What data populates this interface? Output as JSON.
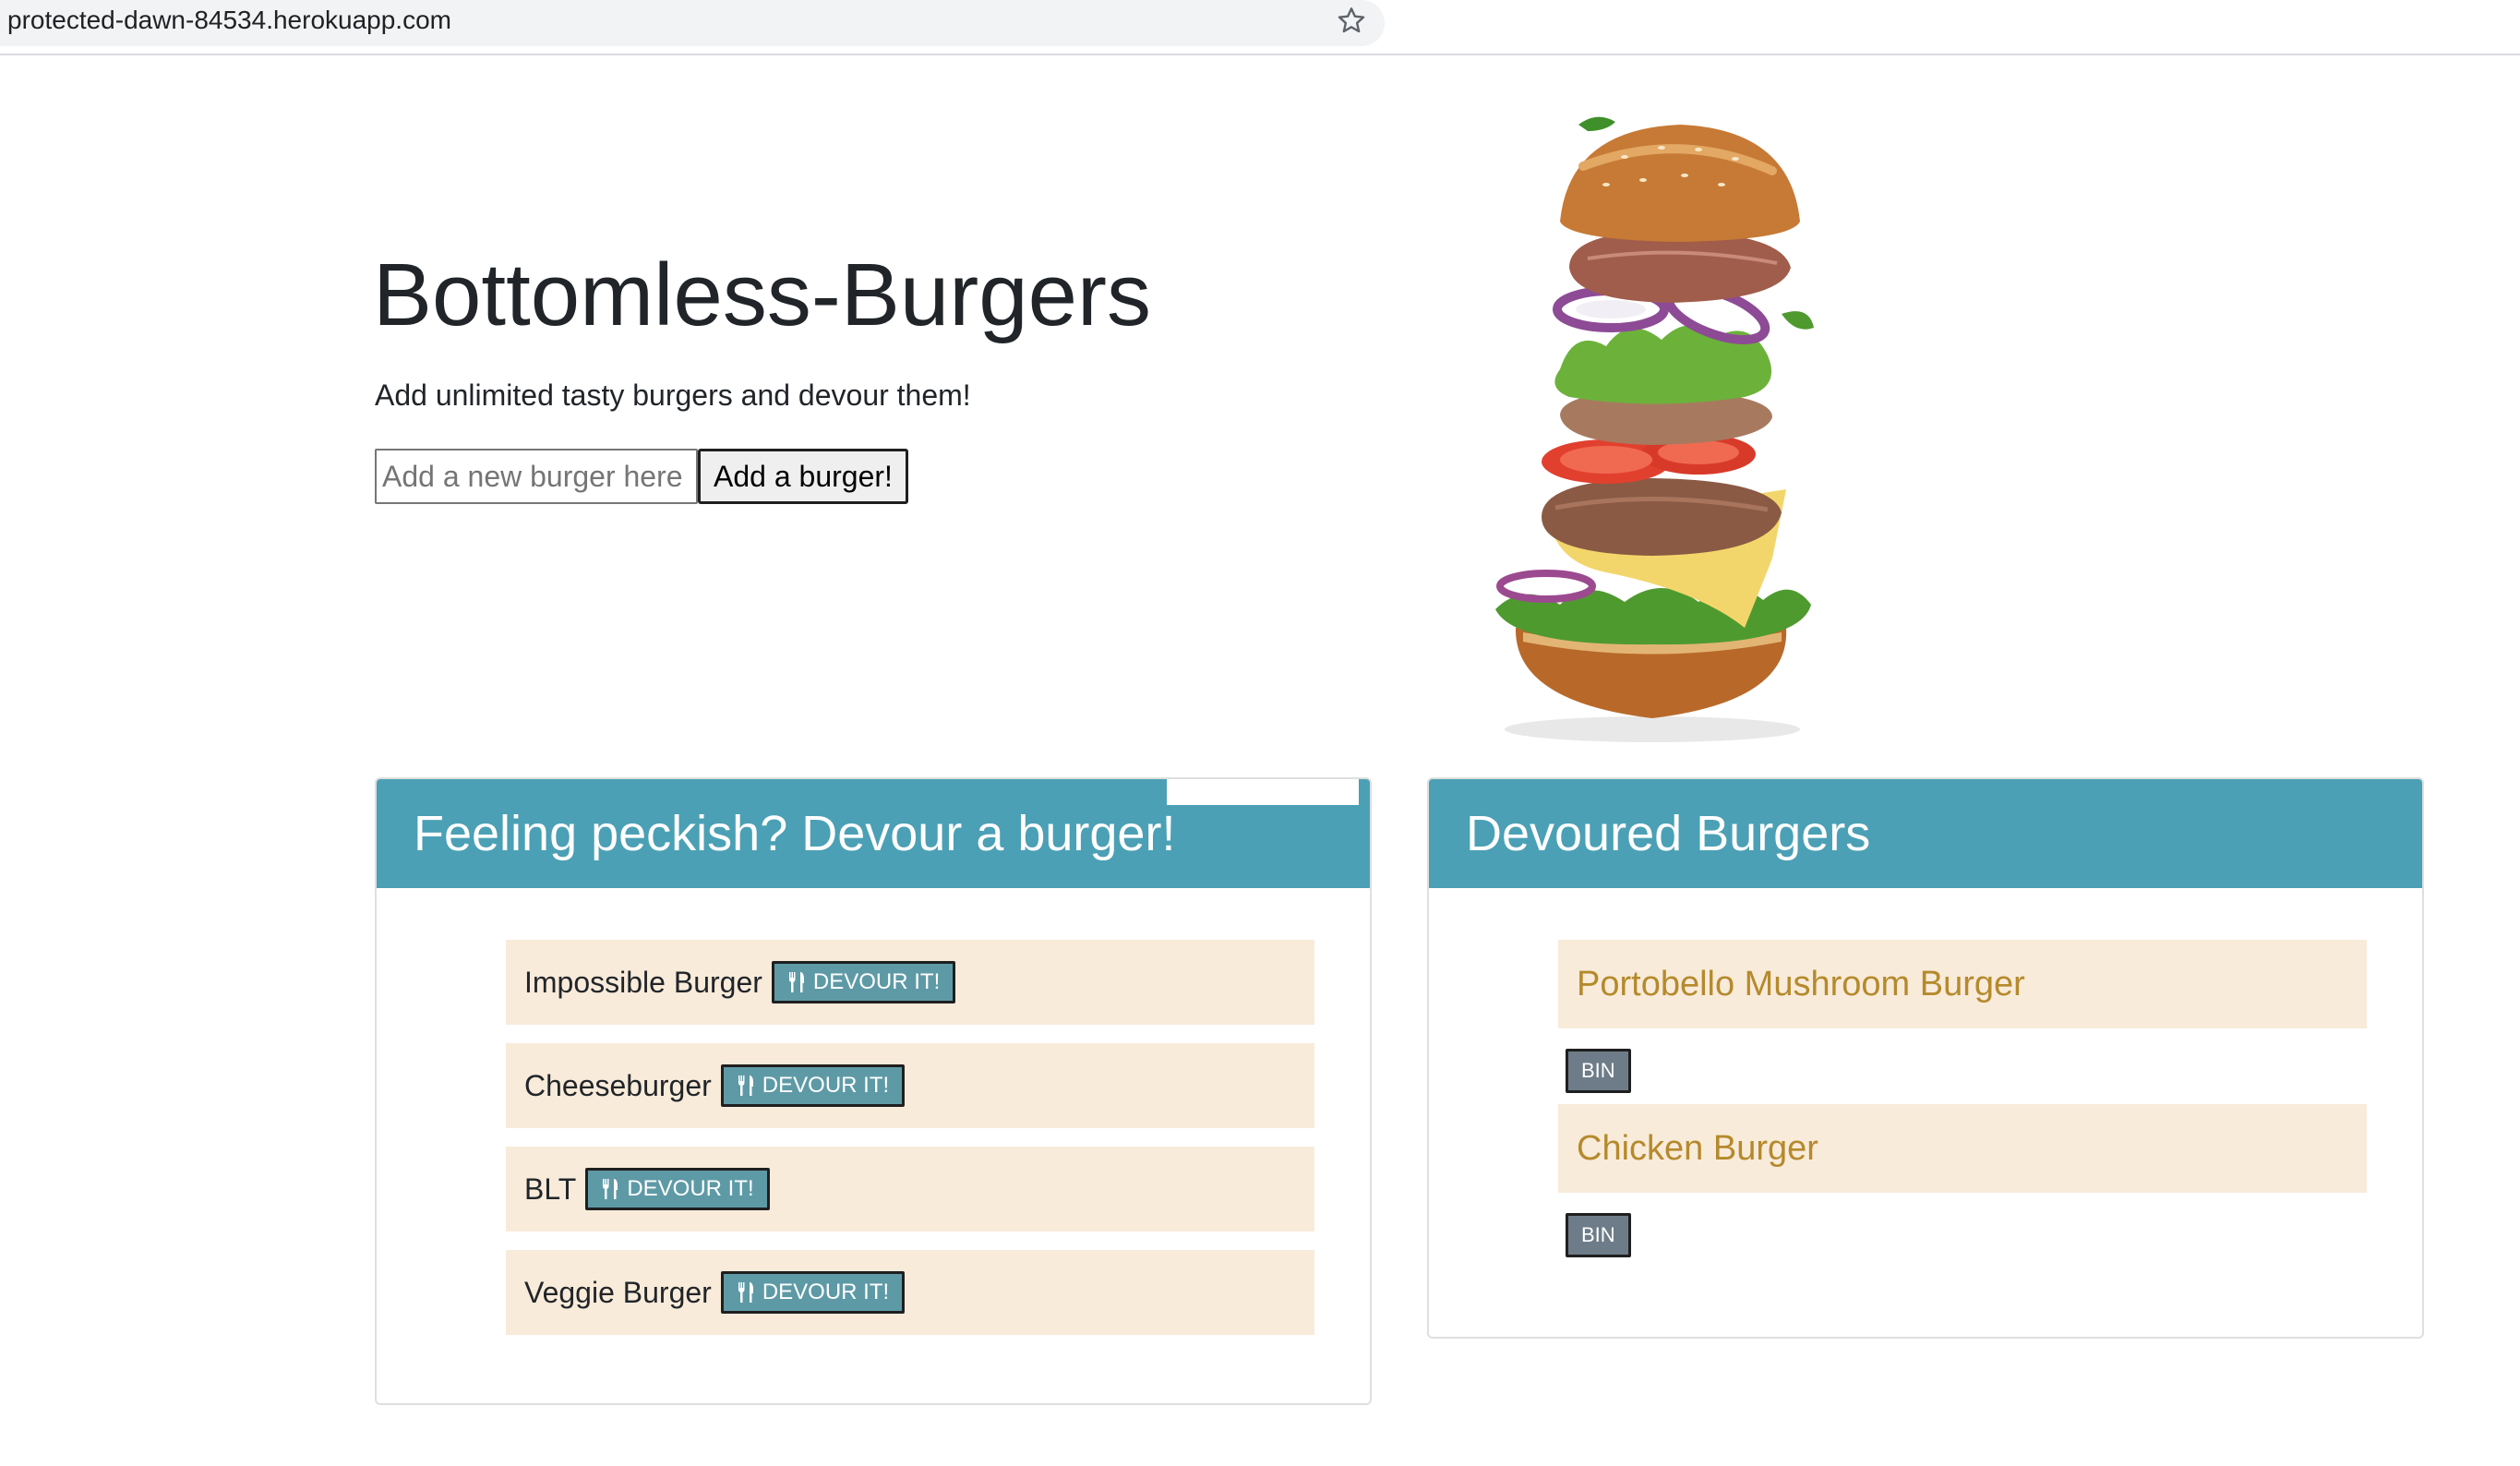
{
  "browser": {
    "url": "protected-dawn-84534.herokuapp.com",
    "bookmark_icon": "star-icon"
  },
  "hero": {
    "title": "Bottomless-Burgers",
    "subtitle": "Add unlimited tasty burgers and devour them!",
    "input_placeholder": "Add a new burger here",
    "input_value": "",
    "add_button_label": "Add a burger!"
  },
  "illustration": {
    "icon": "burger-illustration"
  },
  "undevoured": {
    "heading": "Feeling peckish? Devour a burger!",
    "button_icon": "utensils-icon",
    "items": [
      {
        "name": "Impossible Burger",
        "button_label": "DEVOUR IT!"
      },
      {
        "name": "Cheeseburger",
        "button_label": "DEVOUR IT!"
      },
      {
        "name": "BLT",
        "button_label": "DEVOUR IT!"
      },
      {
        "name": "Veggie Burger",
        "button_label": "DEVOUR IT!"
      }
    ]
  },
  "devoured": {
    "heading": "Devoured Burgers",
    "items": [
      {
        "name": "Portobello Mushroom Burger",
        "button_label": "BIN"
      },
      {
        "name": "Chicken Burger",
        "button_label": "BIN"
      }
    ]
  },
  "colors": {
    "card_header": "#4ba0b5",
    "item_background": "#f8ebda",
    "devour_button": "#5e9aa6",
    "bin_button": "#6d7c88",
    "devoured_text": "#b58a2c"
  }
}
